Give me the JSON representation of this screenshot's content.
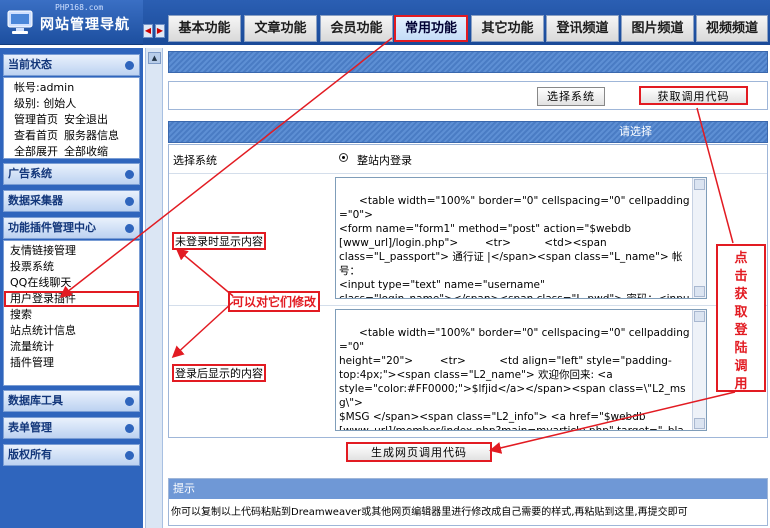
{
  "logo": {
    "site": "PHP168.com",
    "title": "网站管理导航"
  },
  "nav": {
    "prev": "◀",
    "next": "▶"
  },
  "tabs": [
    {
      "label": "基本功能"
    },
    {
      "label": "文章功能"
    },
    {
      "label": "会员功能"
    },
    {
      "label": "常用功能"
    },
    {
      "label": "其它功能"
    },
    {
      "label": "登讯频道"
    },
    {
      "label": "图片频道"
    },
    {
      "label": "视频频道"
    }
  ],
  "sidebar": {
    "status_title": "当前状态",
    "account": "帐号:admin",
    "level": "级别: 创始人",
    "links": [
      [
        "管理首页",
        "安全退出"
      ],
      [
        "查看首页",
        "服务器信息"
      ],
      [
        "全部展开",
        "全部收缩"
      ]
    ],
    "ad": "广告系统",
    "collector": "数据采集器",
    "plugin_title": "功能插件管理中心",
    "plugins": [
      "友情链接管理",
      "投票系统",
      "QQ在线聊天",
      "用户登录插件",
      "搜索",
      "站点统计信息",
      "流量统计",
      "插件管理"
    ],
    "db": "数据库工具",
    "form": "表单管理",
    "copyright": "版权所有"
  },
  "main": {
    "select_btn": "选择系统",
    "get_code_btn": "获取调用代码",
    "section_header": "请选择",
    "select_system_label": "选择系统",
    "radio_label": "整站内登录",
    "before_label": "未登录时显示内容",
    "before_code": "<table width=\"100%\" border=\"0\" cellspacing=\"0\" cellpadding=\"0\">\n<form name=\"form1\" method=\"post\" action=\"$webdb\n[www_url]/login.php\">        <tr>          <td><span\nclass=\"L_passport\"> 通行证 |</span><span class=\"L_name\"> 帐号：\n<input type=\"text\" name=\"username\"\nclass=\"login_name\"></span><span class=\"L_pwd\"> 密码：<input\ntype=\"password\" name=\"password\" class=\"login_pwd\"></span><span\nclass=\"L_sub\"> <input type=\"submit\" name=\"Submit\" value=\"登录\"",
    "after_label": "登录后显示的内容",
    "after_code": "<table width=\"100%\" border=\"0\" cellspacing=\"0\" cellpadding=\"0\"\nheight=\"20\">        <tr>          <td align=\"left\" style=\"padding-\ntop:4px;\"><span class=\"L2_name\"> 欢迎你回来: <a\nstyle=\"color:#FF0000;\">$lfjid</a></span><span class=\\\"L2_msg\\\">\n$MSG </span><span class=\"L2_info\"> <a href=\"$webdb\n[www_url]/member/index.php?main=myarticle.php\" target=\"_blank\">我\n的文章</a> <a href=\"$webdb[www_url]/member/\" target=\"_blank\">\n个人信息</a></span><span class=\"L2_out\"> <a href=\"$webdb",
    "gen_btn": "生成网页调用代码",
    "tip_title": "提示",
    "tip_text": "你可以复制以上代码粘贴到Dreamweaver或其他网页编辑器里进行修改成自己需要的样式,再粘贴到这里,再提交即可"
  },
  "annotations": {
    "modify_note": "可以对它们修改",
    "vertical_note": [
      "点",
      "击",
      "获",
      "取",
      "登",
      "陆",
      "调",
      "用"
    ]
  },
  "colors": {
    "annotation": "#e21b22",
    "nav_blue": "#2f65bd"
  }
}
